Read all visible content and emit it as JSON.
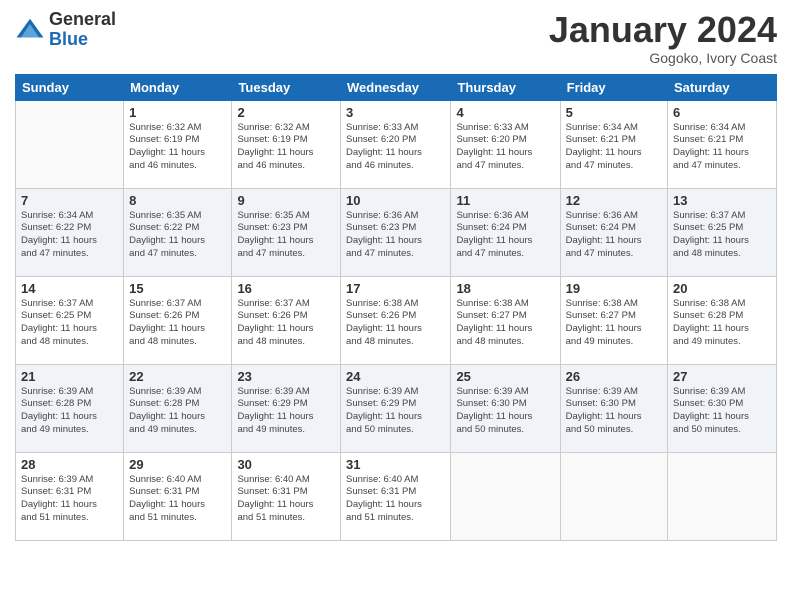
{
  "logo": {
    "general": "General",
    "blue": "Blue"
  },
  "title": "January 2024",
  "subtitle": "Gogoko, Ivory Coast",
  "days_header": [
    "Sunday",
    "Monday",
    "Tuesday",
    "Wednesday",
    "Thursday",
    "Friday",
    "Saturday"
  ],
  "weeks": [
    [
      {
        "day": "",
        "info": ""
      },
      {
        "day": "1",
        "info": "Sunrise: 6:32 AM\nSunset: 6:19 PM\nDaylight: 11 hours\nand 46 minutes."
      },
      {
        "day": "2",
        "info": "Sunrise: 6:32 AM\nSunset: 6:19 PM\nDaylight: 11 hours\nand 46 minutes."
      },
      {
        "day": "3",
        "info": "Sunrise: 6:33 AM\nSunset: 6:20 PM\nDaylight: 11 hours\nand 46 minutes."
      },
      {
        "day": "4",
        "info": "Sunrise: 6:33 AM\nSunset: 6:20 PM\nDaylight: 11 hours\nand 47 minutes."
      },
      {
        "day": "5",
        "info": "Sunrise: 6:34 AM\nSunset: 6:21 PM\nDaylight: 11 hours\nand 47 minutes."
      },
      {
        "day": "6",
        "info": "Sunrise: 6:34 AM\nSunset: 6:21 PM\nDaylight: 11 hours\nand 47 minutes."
      }
    ],
    [
      {
        "day": "7",
        "info": "Sunrise: 6:34 AM\nSunset: 6:22 PM\nDaylight: 11 hours\nand 47 minutes."
      },
      {
        "day": "8",
        "info": "Sunrise: 6:35 AM\nSunset: 6:22 PM\nDaylight: 11 hours\nand 47 minutes."
      },
      {
        "day": "9",
        "info": "Sunrise: 6:35 AM\nSunset: 6:23 PM\nDaylight: 11 hours\nand 47 minutes."
      },
      {
        "day": "10",
        "info": "Sunrise: 6:36 AM\nSunset: 6:23 PM\nDaylight: 11 hours\nand 47 minutes."
      },
      {
        "day": "11",
        "info": "Sunrise: 6:36 AM\nSunset: 6:24 PM\nDaylight: 11 hours\nand 47 minutes."
      },
      {
        "day": "12",
        "info": "Sunrise: 6:36 AM\nSunset: 6:24 PM\nDaylight: 11 hours\nand 47 minutes."
      },
      {
        "day": "13",
        "info": "Sunrise: 6:37 AM\nSunset: 6:25 PM\nDaylight: 11 hours\nand 48 minutes."
      }
    ],
    [
      {
        "day": "14",
        "info": "Sunrise: 6:37 AM\nSunset: 6:25 PM\nDaylight: 11 hours\nand 48 minutes."
      },
      {
        "day": "15",
        "info": "Sunrise: 6:37 AM\nSunset: 6:26 PM\nDaylight: 11 hours\nand 48 minutes."
      },
      {
        "day": "16",
        "info": "Sunrise: 6:37 AM\nSunset: 6:26 PM\nDaylight: 11 hours\nand 48 minutes."
      },
      {
        "day": "17",
        "info": "Sunrise: 6:38 AM\nSunset: 6:26 PM\nDaylight: 11 hours\nand 48 minutes."
      },
      {
        "day": "18",
        "info": "Sunrise: 6:38 AM\nSunset: 6:27 PM\nDaylight: 11 hours\nand 48 minutes."
      },
      {
        "day": "19",
        "info": "Sunrise: 6:38 AM\nSunset: 6:27 PM\nDaylight: 11 hours\nand 49 minutes."
      },
      {
        "day": "20",
        "info": "Sunrise: 6:38 AM\nSunset: 6:28 PM\nDaylight: 11 hours\nand 49 minutes."
      }
    ],
    [
      {
        "day": "21",
        "info": "Sunrise: 6:39 AM\nSunset: 6:28 PM\nDaylight: 11 hours\nand 49 minutes."
      },
      {
        "day": "22",
        "info": "Sunrise: 6:39 AM\nSunset: 6:28 PM\nDaylight: 11 hours\nand 49 minutes."
      },
      {
        "day": "23",
        "info": "Sunrise: 6:39 AM\nSunset: 6:29 PM\nDaylight: 11 hours\nand 49 minutes."
      },
      {
        "day": "24",
        "info": "Sunrise: 6:39 AM\nSunset: 6:29 PM\nDaylight: 11 hours\nand 50 minutes."
      },
      {
        "day": "25",
        "info": "Sunrise: 6:39 AM\nSunset: 6:30 PM\nDaylight: 11 hours\nand 50 minutes."
      },
      {
        "day": "26",
        "info": "Sunrise: 6:39 AM\nSunset: 6:30 PM\nDaylight: 11 hours\nand 50 minutes."
      },
      {
        "day": "27",
        "info": "Sunrise: 6:39 AM\nSunset: 6:30 PM\nDaylight: 11 hours\nand 50 minutes."
      }
    ],
    [
      {
        "day": "28",
        "info": "Sunrise: 6:39 AM\nSunset: 6:31 PM\nDaylight: 11 hours\nand 51 minutes."
      },
      {
        "day": "29",
        "info": "Sunrise: 6:40 AM\nSunset: 6:31 PM\nDaylight: 11 hours\nand 51 minutes."
      },
      {
        "day": "30",
        "info": "Sunrise: 6:40 AM\nSunset: 6:31 PM\nDaylight: 11 hours\nand 51 minutes."
      },
      {
        "day": "31",
        "info": "Sunrise: 6:40 AM\nSunset: 6:31 PM\nDaylight: 11 hours\nand 51 minutes."
      },
      {
        "day": "",
        "info": ""
      },
      {
        "day": "",
        "info": ""
      },
      {
        "day": "",
        "info": ""
      }
    ]
  ]
}
